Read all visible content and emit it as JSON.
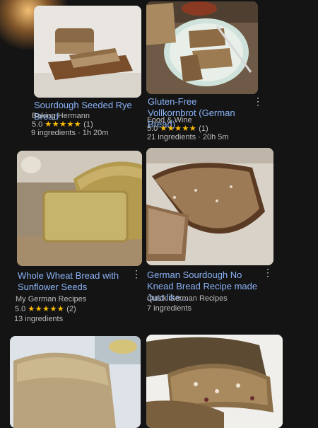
{
  "recipes": [
    {
      "title": "Sourdough Seeded Rye Bread",
      "source": "Baking Hermann",
      "rating": "5.0",
      "stars": "★★★★★",
      "count": "(1)",
      "meta": "9 ingredients · 1h 20m"
    },
    {
      "title": "Gluten-Free Vollkornbrot (German Bread)",
      "source": "Food & Wine",
      "rating": "5.0",
      "stars": "★★★★★",
      "count": "(1)",
      "meta": "21 ingredients · 20h 5m"
    },
    {
      "title": "Whole Wheat Bread with Sunflower Seeds",
      "source": "My German Recipes",
      "rating": "5.0",
      "stars": "★★★★★",
      "count": "(2)",
      "meta": "13 ingredients"
    },
    {
      "title": "German Sourdough No Knead Bread Recipe made Just like...",
      "source": "Quick German Recipes",
      "meta": "7 ingredients"
    },
    {
      "title": ""
    },
    {
      "title": ""
    }
  ],
  "icons": {
    "more": "more-vert-icon",
    "star": "star-icon"
  },
  "colors": {
    "title_link": "#8ab4f8",
    "stars": "#fbbc04",
    "background": "#141414"
  }
}
